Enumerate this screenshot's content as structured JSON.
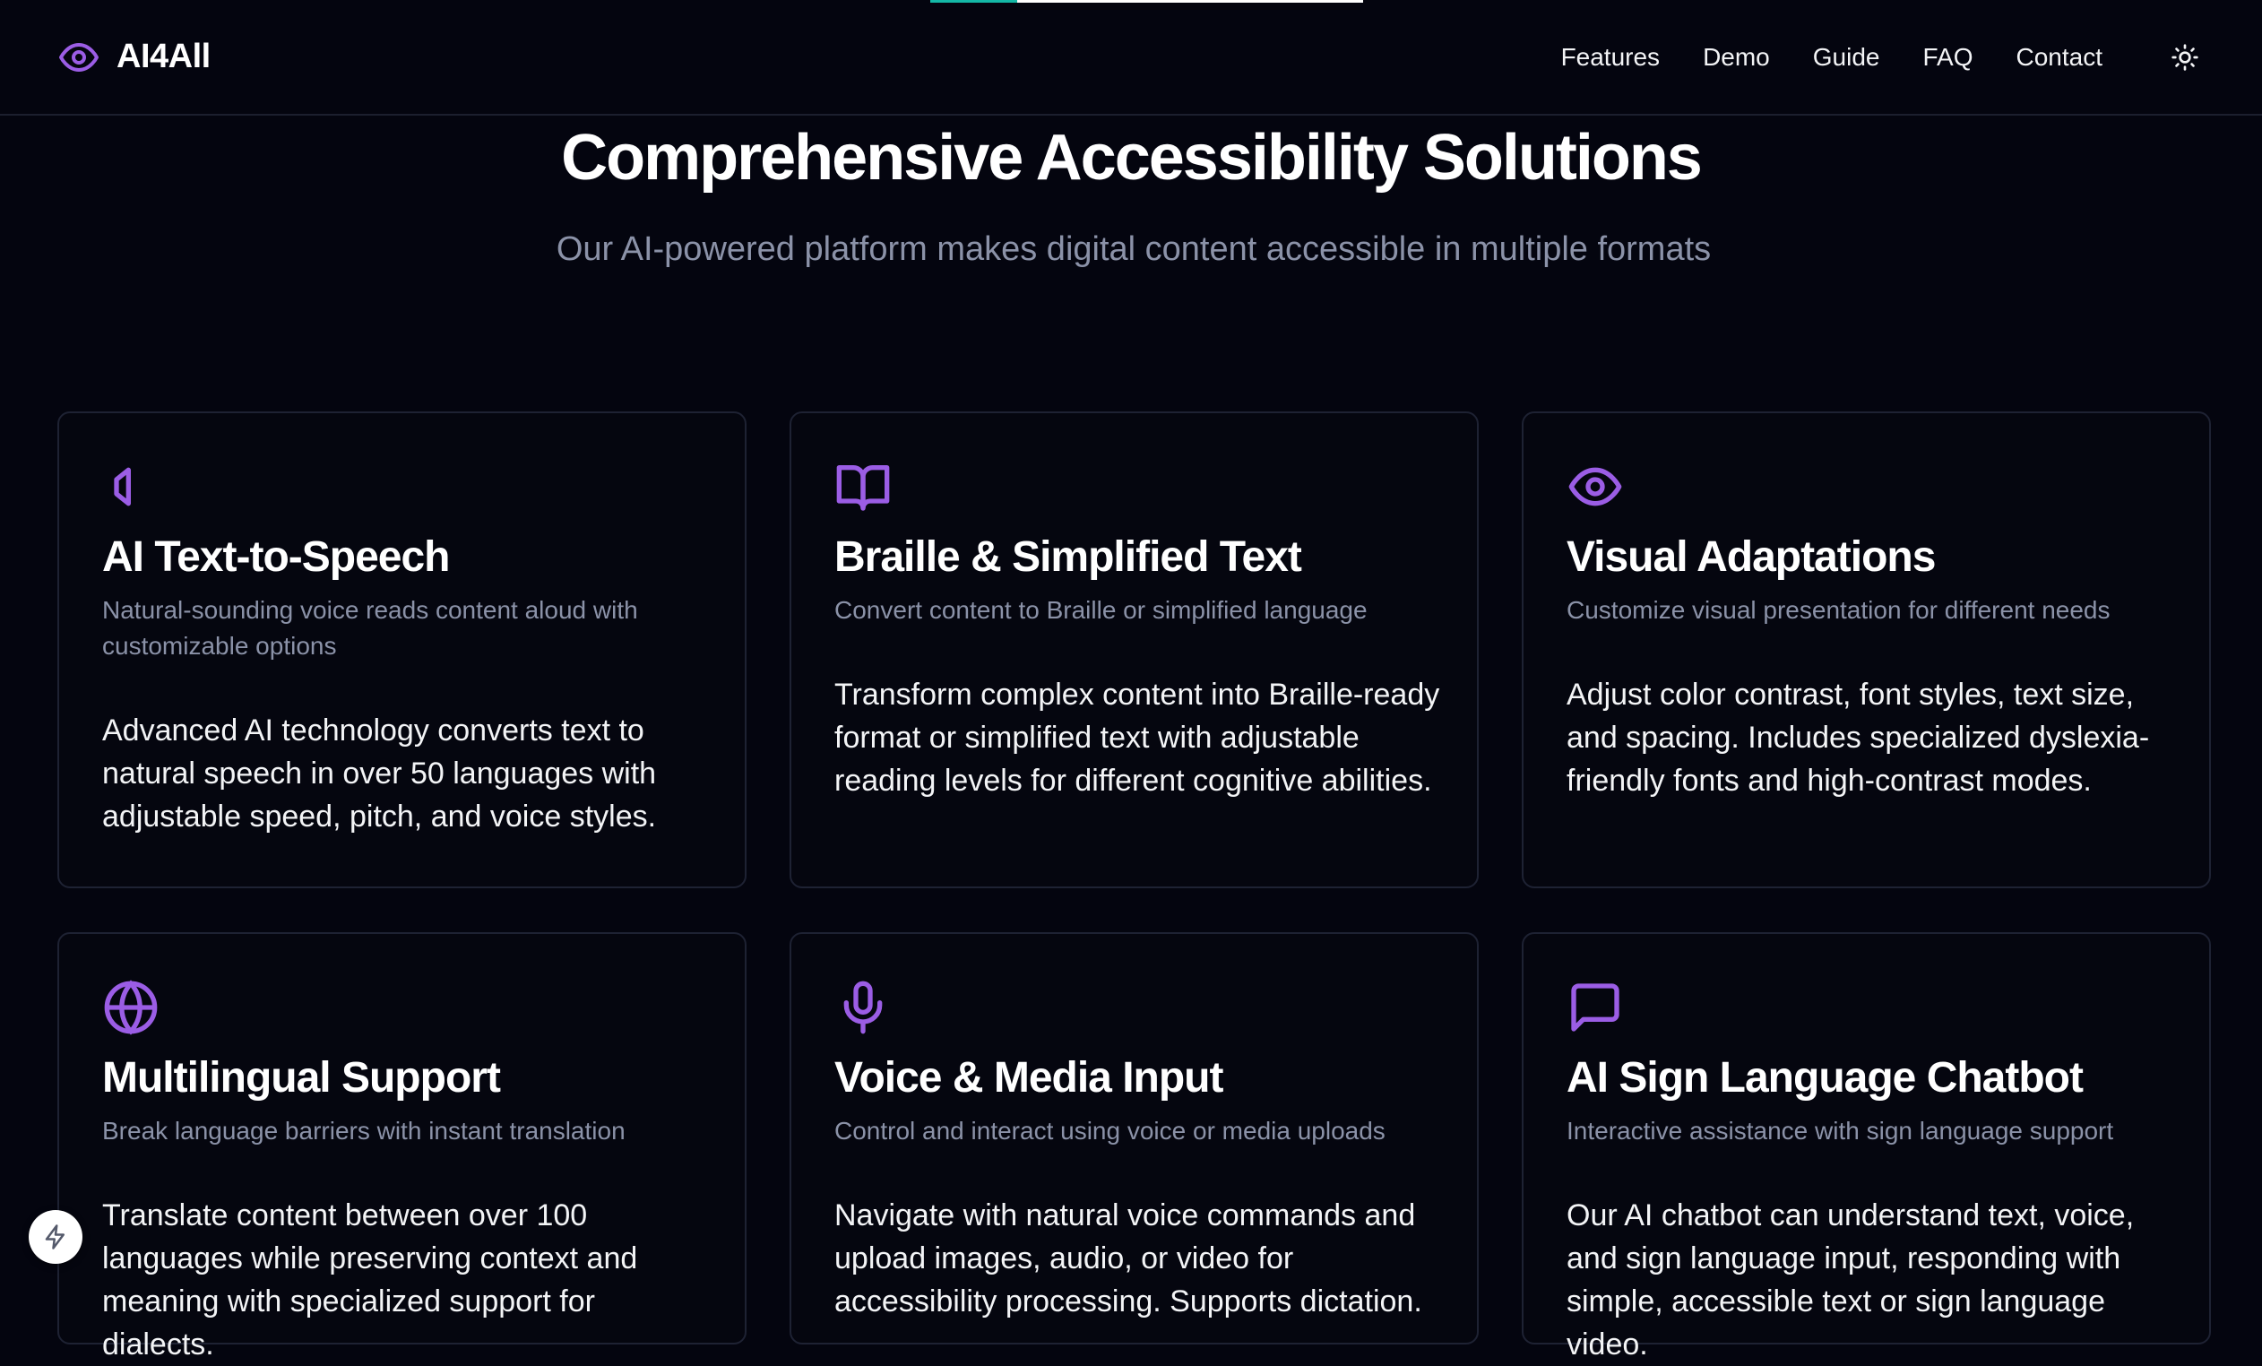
{
  "scroll_progress": 0.2,
  "colors": {
    "accent": "#9b5de5",
    "progress": "#14b8a6",
    "background": "#04050f"
  },
  "header": {
    "logo_icon": "eye-icon",
    "brand": "AI4All",
    "nav": [
      "Features",
      "Demo",
      "Guide",
      "FAQ",
      "Contact"
    ],
    "theme_icon": "sun-icon"
  },
  "hero": {
    "title": "Comprehensive Accessibility Solutions",
    "subtitle": "Our AI-powered platform makes digital content accessible in multiple formats"
  },
  "cards": [
    {
      "icon": "speaker-icon",
      "title": "AI Text-to-Speech",
      "subtitle": "Natural-sounding voice reads content aloud with customizable options",
      "body": "Advanced AI technology converts text to natural speech in over 50 languages with adjustable speed, pitch, and voice styles."
    },
    {
      "icon": "book-open-icon",
      "title": "Braille & Simplified Text",
      "subtitle": "Convert content to Braille or simplified language",
      "body": "Transform complex content into Braille-ready format or simplified text with adjustable reading levels for different cognitive abilities."
    },
    {
      "icon": "eye-icon",
      "title": "Visual Adaptations",
      "subtitle": "Customize visual presentation for different needs",
      "body": "Adjust color contrast, font styles, text size, and spacing. Includes specialized dyslexia-friendly fonts and high-contrast modes."
    },
    {
      "icon": "globe-icon",
      "title": "Multilingual Support",
      "subtitle": "Break language barriers with instant translation",
      "body": "Translate content between over 100 languages while preserving context and meaning with specialized support for dialects."
    },
    {
      "icon": "microphone-icon",
      "title": "Voice & Media Input",
      "subtitle": "Control and interact using voice or media uploads",
      "body": "Navigate with natural voice commands and upload images, audio, or video for accessibility processing. Supports dictation."
    },
    {
      "icon": "message-square-icon",
      "title": "AI Sign Language Chatbot",
      "subtitle": "Interactive assistance with sign language support",
      "body": "Our AI chatbot can understand text, voice, and sign language input, responding with simple, accessible text or sign language video."
    }
  ],
  "fab_icon": "lightning-icon"
}
